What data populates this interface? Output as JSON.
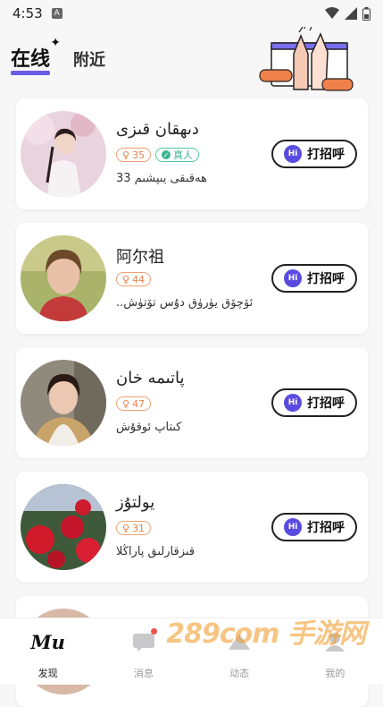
{
  "status_bar": {
    "time": "4:53",
    "badge": "A"
  },
  "header": {
    "tab_online": "在线",
    "tab_nearby": "附近"
  },
  "colors": {
    "accent": "#6b5ce7",
    "age_badge": "#e8804a",
    "real_badge": "#39b591"
  },
  "users": [
    {
      "name": "دىهقان قىزى",
      "age": "35",
      "verified": true,
      "verified_label": "真人",
      "bio": "ھەقىقى يىپشىم 33",
      "greet_label": "打招呼",
      "hi": "Hi"
    },
    {
      "name": "阿尔祖",
      "age": "44",
      "verified": false,
      "bio": "..ئۆچۆق يۈرۈق دۇس تۆتۈش",
      "greet_label": "打招呼",
      "hi": "Hi"
    },
    {
      "name": "پاتىمە خان",
      "age": "47",
      "verified": false,
      "bio": "كىتاپ ئوقۇش",
      "greet_label": "打招呼",
      "hi": "Hi"
    },
    {
      "name": "يولتۇز",
      "age": "31",
      "verified": false,
      "bio": "قىزقارلىق پاراڭلا",
      "greet_label": "打招呼",
      "hi": "Hi"
    }
  ],
  "bottom_nav": {
    "items": [
      {
        "label": "发现",
        "icon": "mu-logo-icon",
        "logo_text": "Mu"
      },
      {
        "label": "消息",
        "icon": "message-icon"
      },
      {
        "label": "动态",
        "icon": "moments-icon"
      },
      {
        "label": "我的",
        "icon": "profile-icon"
      }
    ]
  },
  "watermark": "289com 手游网"
}
